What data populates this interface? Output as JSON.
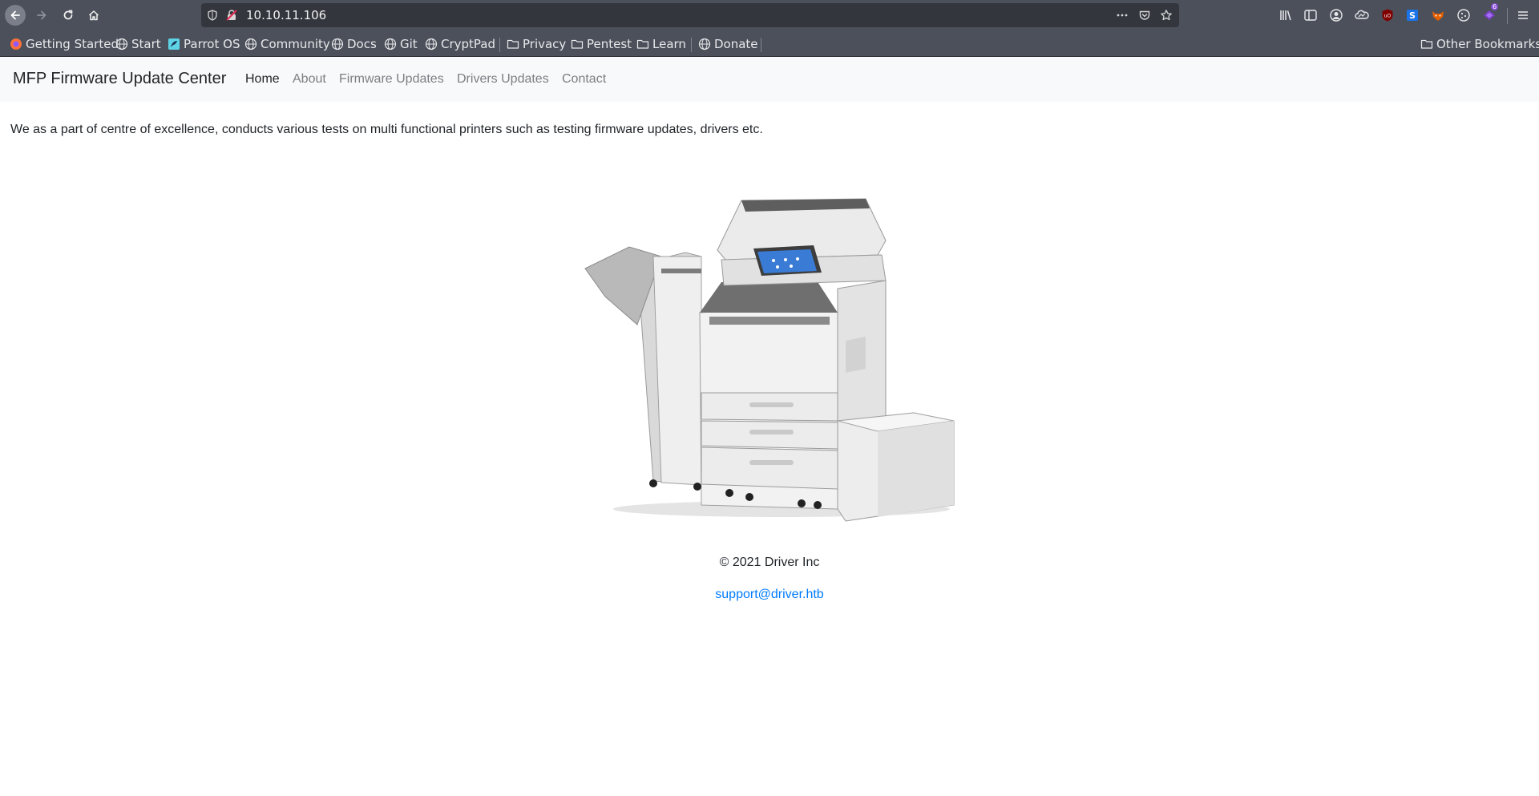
{
  "browser": {
    "url": "10.10.11.106",
    "bookmarks": [
      {
        "label": "Getting Started",
        "icon": "firefox-icon"
      },
      {
        "label": "Start",
        "icon": "globe-icon"
      },
      {
        "label": "Parrot OS",
        "icon": "parrot-icon"
      },
      {
        "label": "Community",
        "icon": "globe-icon"
      },
      {
        "label": "Docs",
        "icon": "globe-icon"
      },
      {
        "label": "Git",
        "icon": "globe-icon"
      },
      {
        "label": "CryptPad",
        "icon": "globe-icon"
      },
      {
        "label": "Privacy",
        "icon": "folder-icon"
      },
      {
        "label": "Pentest",
        "icon": "folder-icon"
      },
      {
        "label": "Learn",
        "icon": "folder-icon"
      },
      {
        "label": "Donate",
        "icon": "globe-icon"
      }
    ],
    "other_bookmarks": "Other Bookmarks",
    "extension_badge": "6"
  },
  "site": {
    "brand": "MFP Firmware Update Center",
    "nav": [
      "Home",
      "About",
      "Firmware Updates",
      "Drivers Updates",
      "Contact"
    ],
    "intro": "We as a part of centre of excellence, conducts various tests on multi functional printers such as testing firmware updates, drivers etc.",
    "copyright": "© 2021 Driver Inc",
    "support_email": "support@driver.htb"
  },
  "colors": {
    "chrome": "#4b505b",
    "urlbar": "#33363d",
    "navbar": "#f8f9fa",
    "link": "#007bff"
  }
}
